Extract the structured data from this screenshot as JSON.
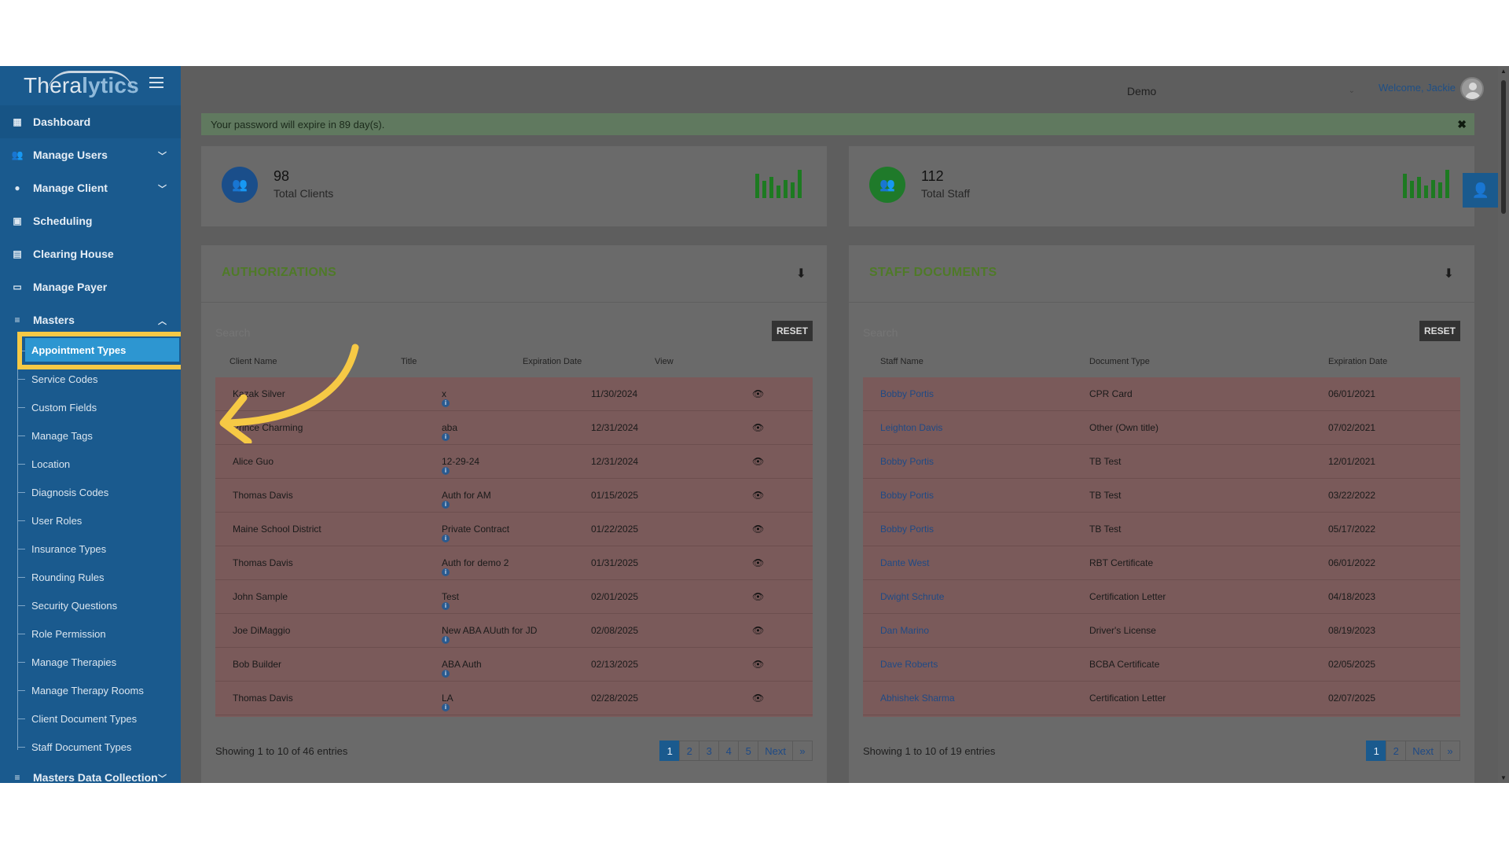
{
  "brand": {
    "name_part1": "Thera",
    "name_part2": "lytics"
  },
  "sidebar": {
    "items": [
      {
        "label": "Dashboard",
        "icon": "dashboard-icon",
        "glyph": "▦"
      },
      {
        "label": "Manage Users",
        "icon": "users-icon",
        "glyph": "👥",
        "chevron": "down"
      },
      {
        "label": "Manage Client",
        "icon": "user-icon",
        "glyph": "●",
        "chevron": "down"
      },
      {
        "label": "Scheduling",
        "icon": "calendar-icon",
        "glyph": "▣"
      },
      {
        "label": "Clearing House",
        "icon": "id-card-icon",
        "glyph": "▤"
      },
      {
        "label": "Manage Payer",
        "icon": "credit-card-icon",
        "glyph": "▭"
      },
      {
        "label": "Masters",
        "icon": "database-icon",
        "glyph": "≡",
        "chevron": "up"
      }
    ],
    "masters_sub": [
      "Appointment Types",
      "Service Codes",
      "Custom Fields",
      "Manage Tags",
      "Location",
      "Diagnosis Codes",
      "User Roles",
      "Insurance Types",
      "Rounding Rules",
      "Security Questions",
      "Role Permission",
      "Manage Therapies",
      "Manage Therapy Rooms",
      "Client Document Types",
      "Staff Document Types"
    ],
    "last_item": "Masters Data Collection"
  },
  "header": {
    "org_select": "Demo",
    "welcome": "Welcome, Jackie"
  },
  "alert": {
    "text": "Your password will expire in 89 day(s).",
    "close": "✖"
  },
  "stats": {
    "clients": {
      "value": "98",
      "label": "Total Clients",
      "bars": [
        0.85,
        0.6,
        0.75,
        0.45,
        0.65,
        0.55,
        1.0
      ]
    },
    "staff": {
      "value": "112",
      "label": "Total Staff",
      "bars": [
        0.85,
        0.6,
        0.75,
        0.45,
        0.65,
        0.55,
        1.0
      ]
    }
  },
  "authorizations": {
    "title": "AUTHORIZATIONS",
    "search_placeholder": "Search",
    "reset": "RESET",
    "columns": [
      "Client Name",
      "Title",
      "Expiration Date",
      "View"
    ],
    "rows": [
      [
        "Kazak Silver",
        "x",
        "11/30/2024"
      ],
      [
        "Prince Charming",
        "aba",
        "12/31/2024"
      ],
      [
        "Alice Guo",
        "12-29-24",
        "12/31/2024"
      ],
      [
        "Thomas Davis",
        "Auth for AM",
        "01/15/2025"
      ],
      [
        "Maine School District",
        "Private Contract",
        "01/22/2025"
      ],
      [
        "Thomas Davis",
        "Auth for demo 2",
        "01/31/2025"
      ],
      [
        "John Sample",
        "Test",
        "02/01/2025"
      ],
      [
        "Joe DiMaggio",
        "New ABA AUuth for JD",
        "02/08/2025"
      ],
      [
        "Bob Builder",
        "ABA Auth",
        "02/13/2025"
      ],
      [
        "Thomas Davis",
        "LA",
        "02/28/2025"
      ]
    ],
    "showing": "Showing 1 to 10 of 46 entries",
    "pages": [
      "1",
      "2",
      "3",
      "4",
      "5",
      "Next",
      "»"
    ]
  },
  "staff_documents": {
    "title": "STAFF DOCUMENTS",
    "search_placeholder": "Search",
    "reset": "RESET",
    "columns": [
      "Staff Name",
      "Document Type",
      "Expiration Date"
    ],
    "rows": [
      [
        "Bobby Portis",
        "CPR Card",
        "06/01/2021"
      ],
      [
        "Leighton Davis",
        "Other (Own title)",
        "07/02/2021"
      ],
      [
        "Bobby Portis",
        "TB Test",
        "12/01/2021"
      ],
      [
        "Bobby Portis",
        "TB Test",
        "03/22/2022"
      ],
      [
        "Bobby Portis",
        "TB Test",
        "05/17/2022"
      ],
      [
        "Dante West",
        "RBT Certificate",
        "06/01/2022"
      ],
      [
        "Dwight Schrute",
        "Certification Letter",
        "04/18/2023"
      ],
      [
        "Dan Marino",
        "Driver's License",
        "08/19/2023"
      ],
      [
        "Dave Roberts",
        "BCBA Certificate",
        "02/05/2025"
      ],
      [
        "Abhishek Sharma",
        "Certification Letter",
        "02/07/2025"
      ]
    ],
    "showing": "Showing 1 to 10 of 19 entries",
    "pages": [
      "1",
      "2",
      "Next",
      "»"
    ]
  },
  "colors": {
    "sidebar": "#1a5a8e",
    "highlight": "#f6c945",
    "active_item": "#2d96d1",
    "title_green": "#4f7a28"
  }
}
